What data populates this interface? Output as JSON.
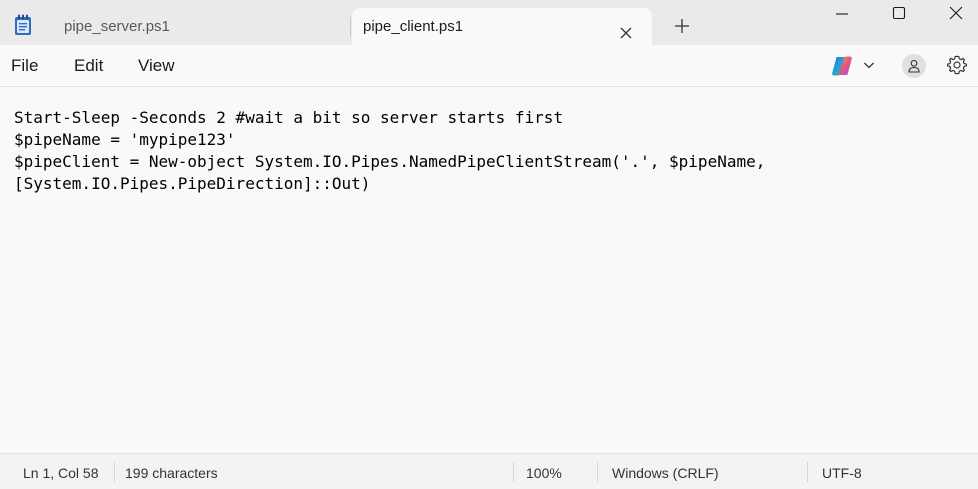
{
  "tabs": [
    {
      "label": "pipe_server.ps1",
      "active": false
    },
    {
      "label": "pipe_client.ps1",
      "active": true
    }
  ],
  "window_controls": {
    "minimize": "minimize-icon",
    "maximize": "maximize-icon",
    "close": "close-icon"
  },
  "menu": {
    "file": "File",
    "edit": "Edit",
    "view": "View"
  },
  "toolbar_icons": [
    "copilot-icon",
    "chevron-down-icon",
    "account-icon",
    "gear-icon"
  ],
  "editor": {
    "lines": [
      "Start-Sleep -Seconds 2 #wait a bit so server starts first",
      "$pipeName = 'mypipe123'",
      "$pipeClient = New-object System.IO.Pipes.NamedPipeClientStream('.', $pipeName,",
      "[System.IO.Pipes.PipeDirection]::Out)"
    ]
  },
  "status": {
    "position": "Ln 1, Col 58",
    "characters": "199 characters",
    "zoom": "100%",
    "line_ending": "Windows (CRLF)",
    "encoding": "UTF-8"
  },
  "colors": {
    "titlebar": "#eaeaea",
    "background": "#f9f9f9",
    "statusbar": "#f3f3f3",
    "notepad_icon": "#2f6bc7"
  }
}
